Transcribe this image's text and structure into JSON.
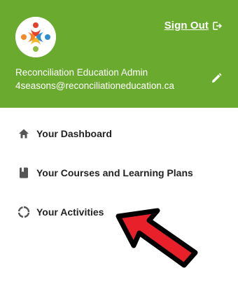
{
  "header": {
    "bg_color": "#6aab2f",
    "sign_out_label": "Sign Out",
    "sign_out_icon": "sign-out-icon",
    "user_name": "Reconciliation Education Admin",
    "user_email": "4seasons@reconciliationeducation.ca",
    "edit_icon": "pencil-icon",
    "avatar_icon": "logo-people-circle"
  },
  "nav": {
    "items": [
      {
        "label": "Your Dashboard",
        "icon": "home-icon"
      },
      {
        "label": "Your Courses and Learning Plans",
        "icon": "book-icon"
      },
      {
        "label": "Your Activities",
        "icon": "activity-ring-icon"
      }
    ]
  },
  "annotation": {
    "arrow_color": "#e8202a",
    "arrow_outline": "#000000"
  }
}
